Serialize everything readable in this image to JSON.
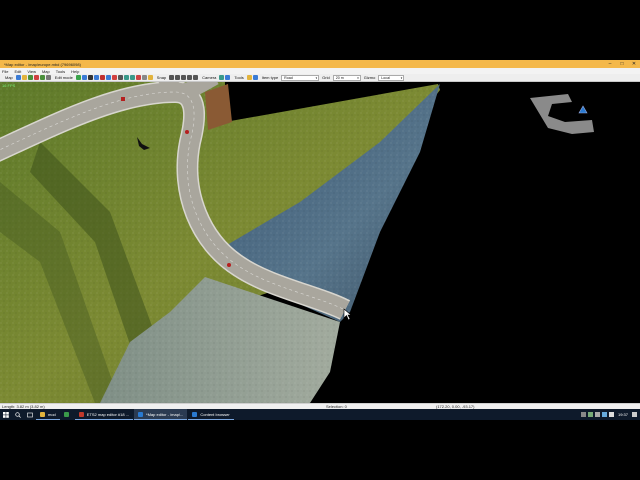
{
  "window": {
    "title": "*Map editor - /map/europe.mbd (79696098)",
    "controls": [
      "–",
      "□",
      "✕"
    ]
  },
  "menu": [
    "File",
    "Edit",
    "View",
    "Map",
    "Tools",
    "Help"
  ],
  "toolbar": {
    "map_label": "Map",
    "edit_mode_label": "Edit mode",
    "snap_label": "Snap",
    "camera_label": "Camera",
    "tools_label": "Tools",
    "item_type_label": "Item type",
    "item_type_value": "Road",
    "grid_label": "Grid",
    "grid_value": "20 m",
    "gizmo_label": "Gizmo",
    "gizmo_value": "Local"
  },
  "viewport": {
    "fps": "16 FPS"
  },
  "status": {
    "length": "Length: 3.82 m (3.82 m)",
    "selection": "Selection: 0",
    "coords": "(172.20, 0.00, -93.17)"
  },
  "taskbar": {
    "items": [
      {
        "label": "mod",
        "active": false
      },
      {
        "label": "ETS2 map editor #18 ...",
        "active": false
      },
      {
        "label": "*Map editor - /map/...",
        "active": true
      },
      {
        "label": "Content browser",
        "active": false
      }
    ],
    "clock": "19:37"
  },
  "colors": {
    "title_bar": "#f4b84a",
    "taskbar": "#0e1a2b",
    "grass": "#6d7d2c",
    "water": "#4f6f86",
    "road": "#b9b6ac"
  }
}
